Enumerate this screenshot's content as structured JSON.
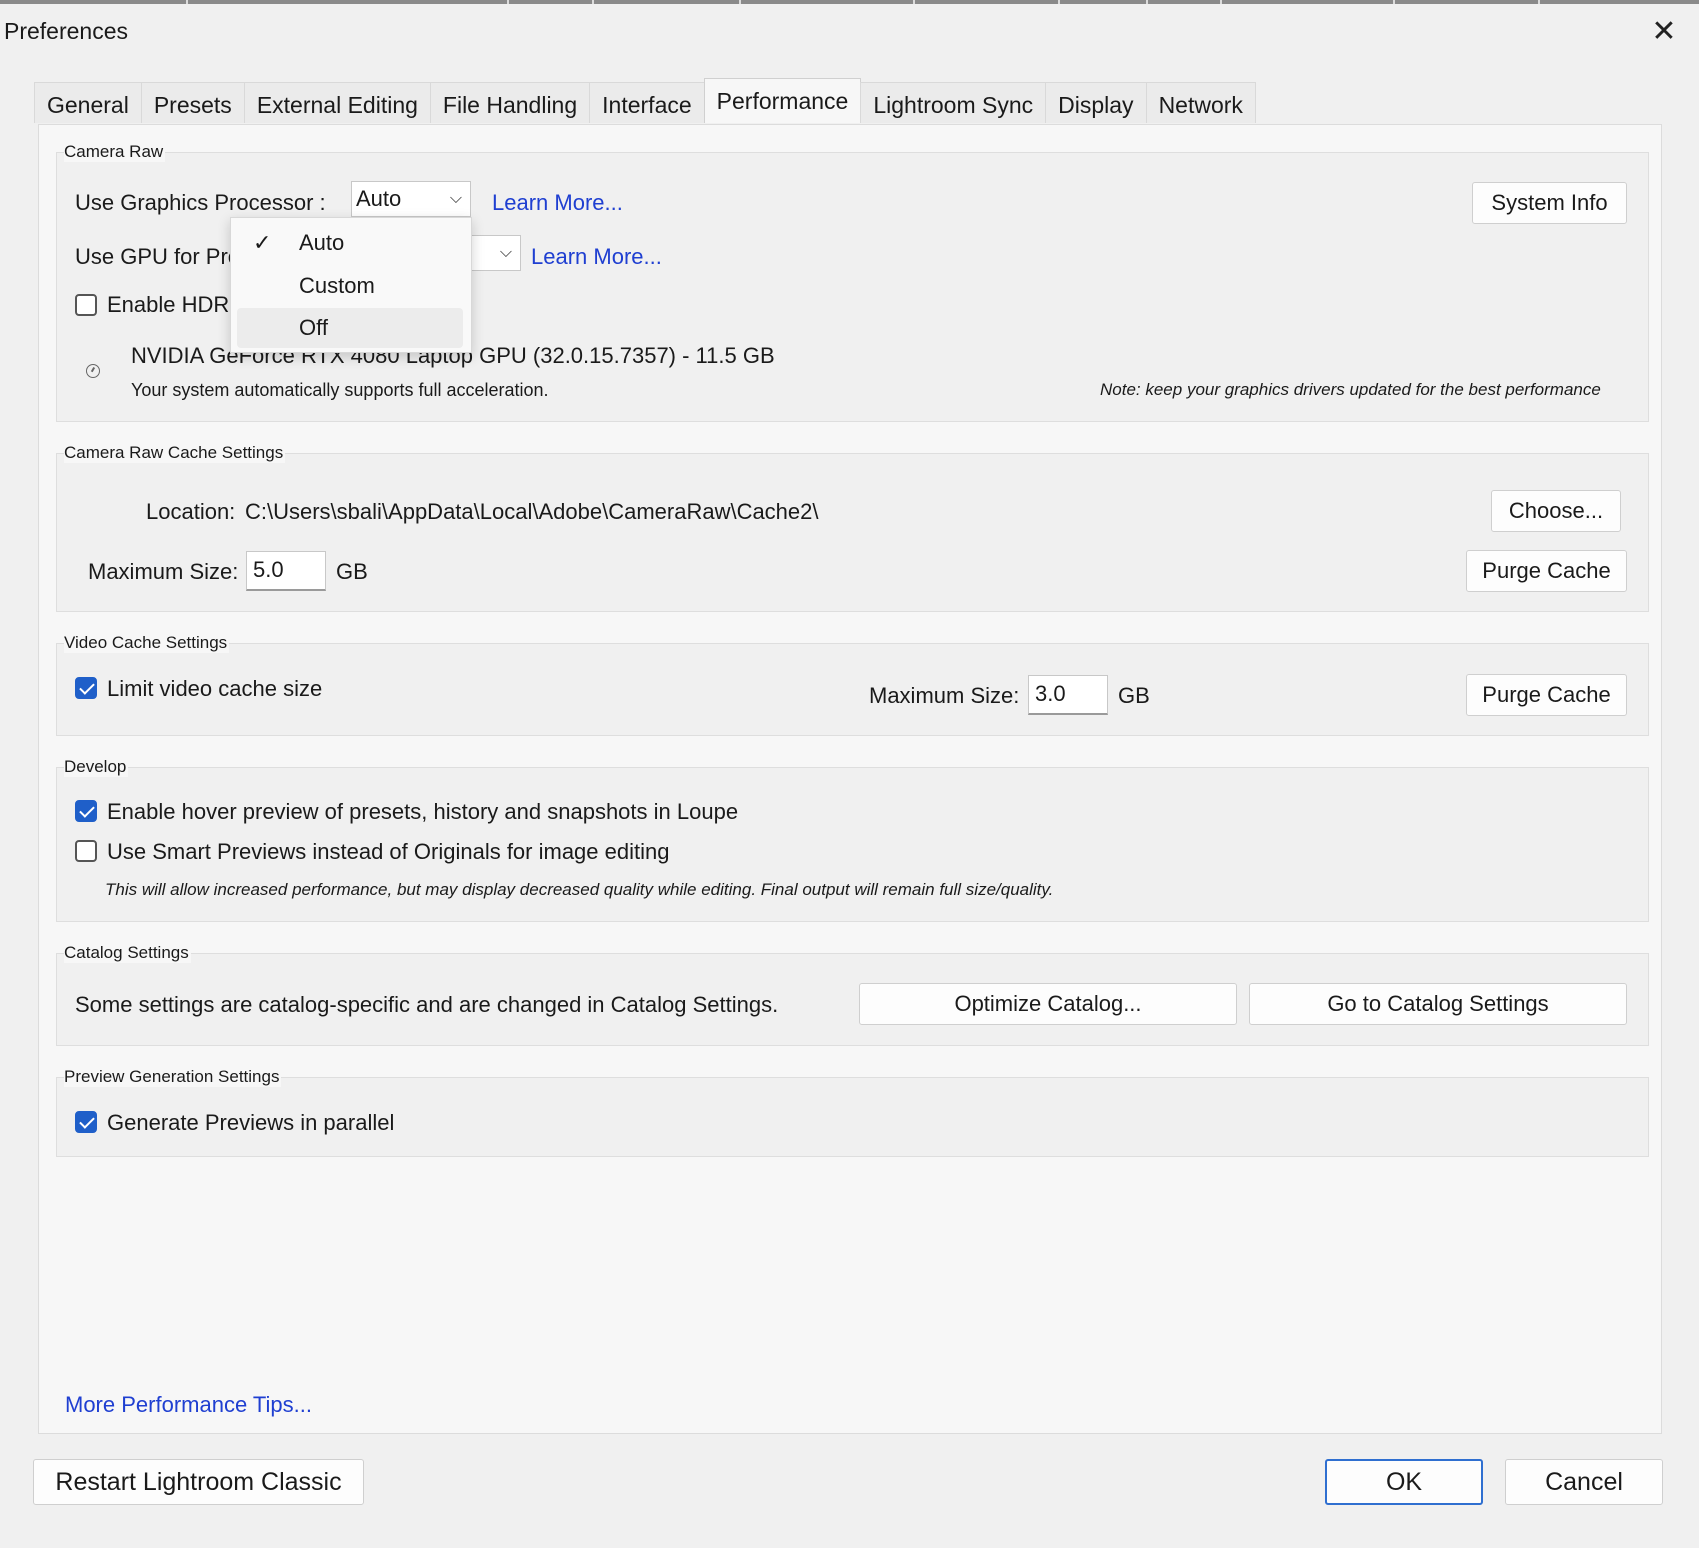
{
  "window": {
    "title": "Preferences",
    "close_icon": "close-icon"
  },
  "tabs": [
    {
      "label": "General"
    },
    {
      "label": "Presets"
    },
    {
      "label": "External Editing"
    },
    {
      "label": "File Handling"
    },
    {
      "label": "Interface"
    },
    {
      "label": "Performance",
      "active": true
    },
    {
      "label": "Lightroom Sync"
    },
    {
      "label": "Display"
    },
    {
      "label": "Network"
    }
  ],
  "camera_raw": {
    "title": "Camera Raw",
    "gpu_label": "Use Graphics Processor :",
    "gpu_value": "Auto",
    "learn_more_1": "Learn More...",
    "gpu_preview_label": "Use GPU for Pre",
    "learn_more_2": "Learn More...",
    "enable_hdr_label": "Enable HDR",
    "enable_hdr_checked": false,
    "system_info_button": "System Info",
    "gpu_name": "NVIDIA GeForce RTX 4080 Laptop GPU (32.0.15.7357) - 11.5 GB",
    "gpu_support_text": "Your system automatically supports full acceleration.",
    "driver_note": "Note: keep your graphics drivers updated for the best performance"
  },
  "gpu_dropdown": {
    "options": [
      {
        "label": "Auto",
        "checked": true
      },
      {
        "label": "Custom"
      },
      {
        "label": "Off",
        "hover": true
      }
    ],
    "check_glyph": "✓"
  },
  "raw_cache": {
    "title": "Camera Raw Cache Settings",
    "location_label": "Location:",
    "location_value": "C:\\Users\\sbali\\AppData\\Local\\Adobe\\CameraRaw\\Cache2\\",
    "choose_button": "Choose...",
    "max_size_label": "Maximum Size:",
    "max_size_value": "5.0",
    "unit": "GB",
    "purge_button": "Purge Cache"
  },
  "video_cache": {
    "title": "Video Cache Settings",
    "limit_label": "Limit video cache size",
    "limit_checked": true,
    "max_size_label": "Maximum Size:",
    "max_size_value": "3.0",
    "unit": "GB",
    "purge_button": "Purge Cache"
  },
  "develop": {
    "title": "Develop",
    "hover_preview_label": "Enable hover preview of presets, history and snapshots in Loupe",
    "hover_preview_checked": true,
    "smart_previews_label": "Use Smart Previews instead of Originals for image editing",
    "smart_previews_checked": false,
    "smart_previews_note": "This will allow increased performance, but may display decreased quality while editing. Final output will remain full size/quality."
  },
  "catalog": {
    "title": "Catalog Settings",
    "description": "Some settings are catalog-specific and are changed in Catalog Settings.",
    "optimize_button": "Optimize Catalog...",
    "goto_button": "Go to Catalog Settings"
  },
  "preview_gen": {
    "title": "Preview Generation Settings",
    "parallel_label": "Generate Previews in parallel",
    "parallel_checked": true
  },
  "footer": {
    "tips_link": "More Performance Tips...",
    "restart_button": "Restart Lightroom Classic",
    "ok_button": "OK",
    "cancel_button": "Cancel"
  },
  "colors": {
    "link": "#1f3fd1",
    "accent": "#1f5fc9"
  }
}
